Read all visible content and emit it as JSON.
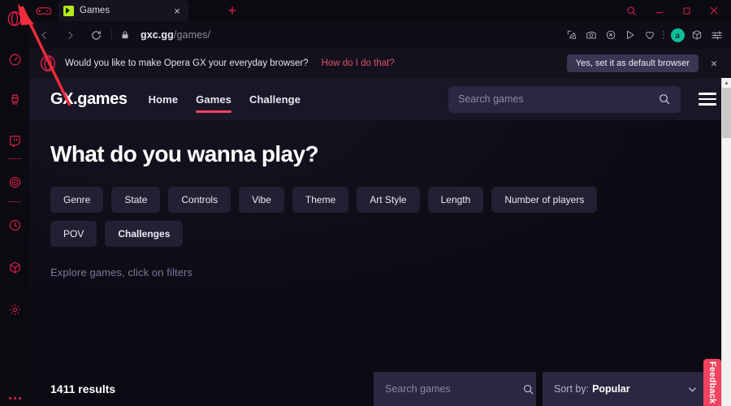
{
  "browser": {
    "window_controls": [
      {
        "name": "search",
        "glyph": "search"
      },
      {
        "name": "minimize",
        "glyph": "minimize"
      },
      {
        "name": "maximize",
        "glyph": "maximize"
      },
      {
        "name": "close",
        "glyph": "close"
      }
    ],
    "tab": {
      "title": "Games",
      "close_label": "×",
      "favicon": "gx-games-favicon"
    },
    "new_tab_label": "+",
    "address": {
      "host": "gxc.gg",
      "path": "/games/",
      "lock_icon": "lock-icon",
      "back_icon": "chevron-left-icon",
      "forward_icon": "chevron-right-icon",
      "reload_icon": "reload-icon"
    },
    "toolbar_icons": [
      "snapshot-edit-icon",
      "camera-icon",
      "x-circle-icon",
      "send-icon",
      "heart-icon"
    ],
    "profile_badge": "a",
    "extra_icons": [
      "package-icon",
      "easy-setup-icon"
    ],
    "sidebar": {
      "logo": "opera-gx-logo-icon",
      "items": [
        {
          "name": "gx-control-icon"
        },
        {
          "name": "gx-cleaner-icon"
        },
        {
          "name": "twitch-icon"
        },
        {
          "name": "divider"
        },
        {
          "name": "player-icon"
        },
        {
          "name": "divider"
        },
        {
          "name": "history-clock-icon"
        },
        {
          "name": "gx-corner-box-icon"
        },
        {
          "name": "settings-gear-icon"
        }
      ],
      "more_label": "•••"
    }
  },
  "notice": {
    "logo": "opera-gx-logo-icon",
    "text": "Would you like to make Opera GX your everyday browser?",
    "link": "How do I do that?",
    "button": "Yes, set it as default browser",
    "close_label": "×"
  },
  "page": {
    "brand": "GX.games",
    "nav": [
      {
        "label": "Home",
        "active": false
      },
      {
        "label": "Games",
        "active": true
      },
      {
        "label": "Challenge",
        "active": false
      }
    ],
    "search": {
      "value": "",
      "placeholder": "Search games",
      "icon": "search-icon"
    },
    "menu_icon": "hamburger-menu-icon",
    "hero": {
      "title": "What do you wanna play?",
      "filters": [
        "Genre",
        "State",
        "Controls",
        "Vibe",
        "Theme",
        "Art Style",
        "Length",
        "Number of players",
        "POV",
        "Challenges"
      ],
      "hint": "Explore games, click on filters"
    },
    "results": {
      "count_label": "1411 results",
      "search": {
        "value": "",
        "placeholder": "Search games",
        "icon": "search-icon"
      },
      "sort": {
        "label": "Sort by:",
        "value": "Popular",
        "caret": "chevron-down-icon"
      }
    },
    "feedback_label": "Feedback"
  },
  "colors": {
    "accent_red": "#e0204a",
    "page_accent": "#f0435f",
    "nav_bg": "#191726",
    "chip_bg": "#241f33",
    "input_bg": "#2b2740",
    "badge_teal": "#0fbf9a",
    "favicon_green": "#b4ec1c"
  }
}
